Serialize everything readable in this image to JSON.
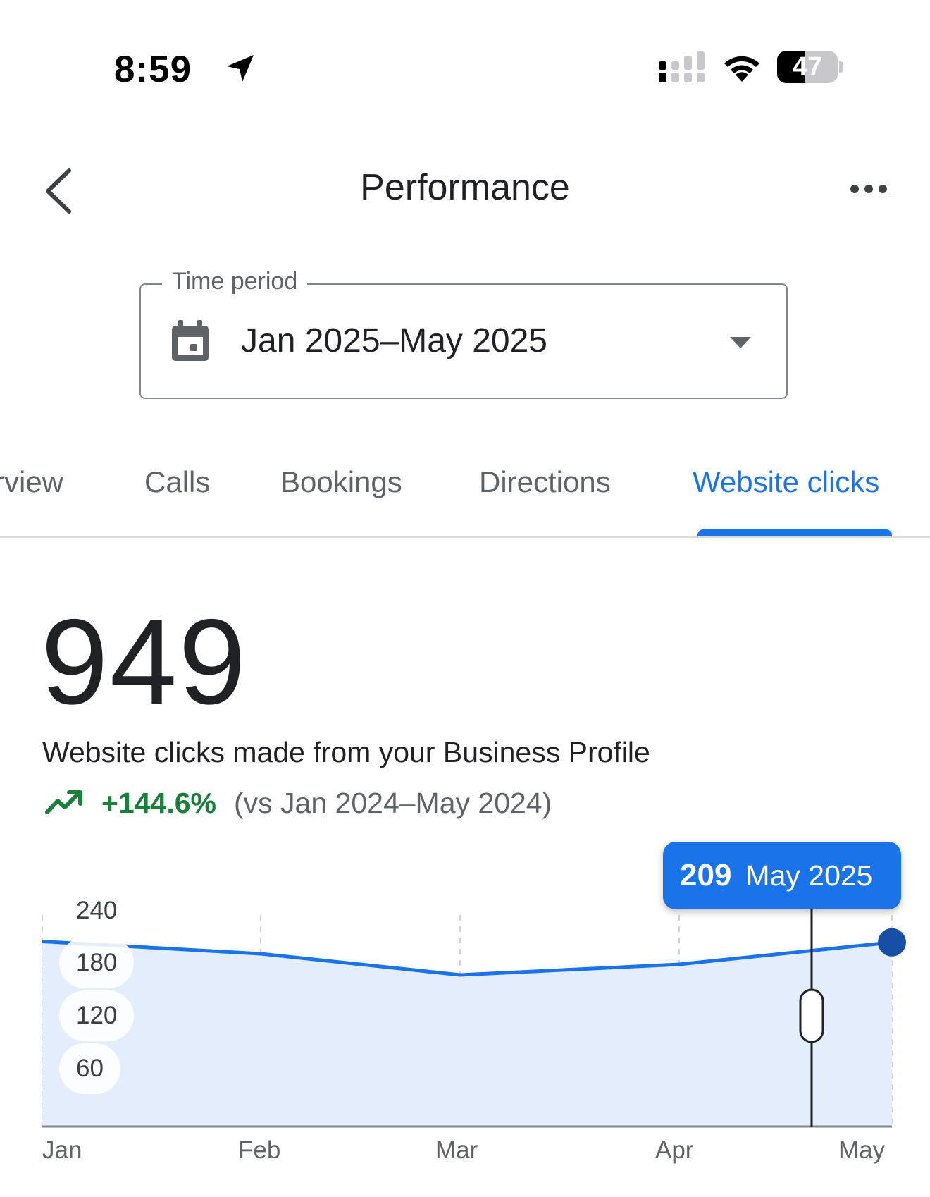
{
  "status_bar": {
    "time": "8:59",
    "battery": "47",
    "battery_level_percent": 47,
    "icons": [
      "location-arrow-icon",
      "signal-icon",
      "wifi-icon",
      "battery-icon"
    ]
  },
  "header": {
    "title": "Performance",
    "back_icon": "chevron-left-icon",
    "more_icon": "more-horizontal-icon"
  },
  "time_period": {
    "label": "Time period",
    "value": "Jan 2025–May 2025",
    "icon": "calendar-icon",
    "dropdown_icon": "caret-down-icon"
  },
  "tabs": [
    {
      "label": "rview",
      "active": false
    },
    {
      "label": "Calls",
      "active": false
    },
    {
      "label": "Bookings",
      "active": false
    },
    {
      "label": "Directions",
      "active": false
    },
    {
      "label": "Website clicks",
      "active": true
    }
  ],
  "metric": {
    "value": "949",
    "description": "Website clicks made from your Business Profile",
    "change": "+144.6%",
    "comparison": "(vs Jan 2024–May 2024)",
    "trend_icon": "trending-up-icon"
  },
  "tooltip": {
    "value": "209",
    "date": "May 2025"
  },
  "colors": {
    "accent": "#1a73e8",
    "positive": "#188038",
    "area_fill": "#e3edfc",
    "marker": "#174ea6"
  },
  "chart_data": {
    "type": "area",
    "categories": [
      "Jan",
      "Feb",
      "Mar",
      "Apr",
      "May"
    ],
    "values": [
      210,
      196,
      172,
      184,
      209
    ],
    "y_ticks": [
      "240",
      "180",
      "120",
      "60"
    ],
    "ylim": [
      0,
      240
    ],
    "grid": "vertical-dashed",
    "highlight": {
      "category": "May",
      "value": 209
    }
  }
}
